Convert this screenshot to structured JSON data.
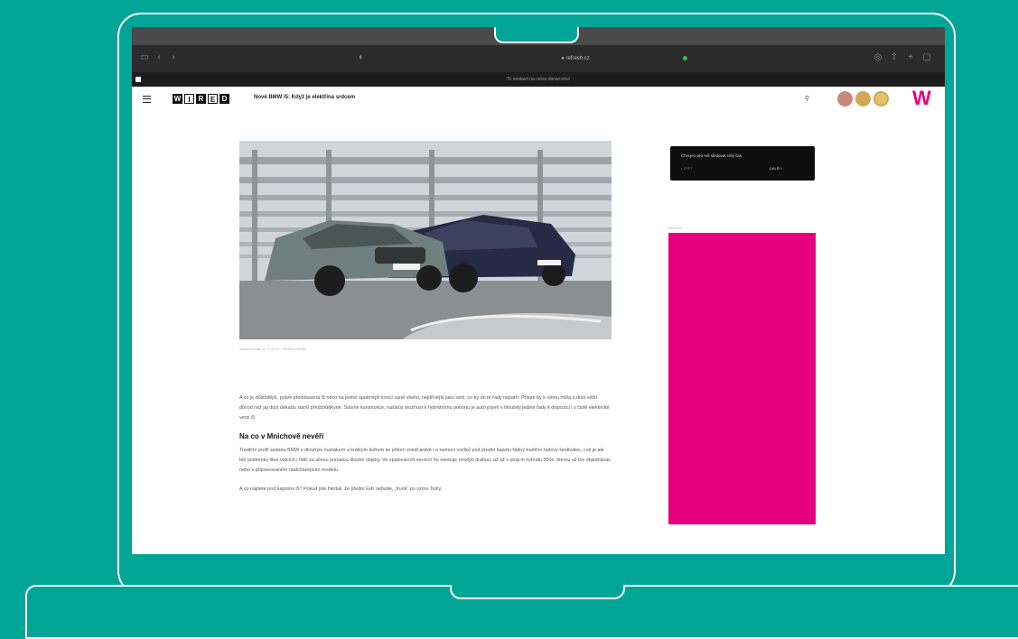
{
  "browser": {
    "url": "● refresh.cz",
    "notice": "To nastavit na celou obrazovku!",
    "icons": [
      "sidebar-icon",
      "chevron-left-icon",
      "chevron-right-icon",
      "shield-icon",
      "share-icon",
      "plus-icon",
      "tabs-icon"
    ]
  },
  "site": {
    "logo_letters": [
      "W",
      "I",
      "R",
      "E",
      "D"
    ],
    "header_title": "Nové BMW i5: Když je elektřina srdcem",
    "accent": "#e6007e",
    "coin_colors": [
      "#c8887a",
      "#d2a857",
      "#e2c46a"
    ],
    "brand_mark": "W"
  },
  "article": {
    "image_caption": "Autorem fotky je, © 2024 – Refresh BMW",
    "paragraph_1": "A co je důležitější, právě představená i5 něco na jedné opatrnější koncí vaně všeho, nejdřívější jako sérii, co by do té řady nepatří. Přitom by k němu měla o dost větší důvod než jaj dost dekádu starší předchůdkyně. Stavné konstrukce, našla/si možnost k hybridnímu pohonu je auto pojetí v hlouběji jediné řady k dispozici i v čistě elektrické verzi i5.",
    "heading": "Na co v Mnichově nevěří",
    "paragraph_2": "Tradiční profil sedanu BMW s dlouhým čumákem a krátkým kufrem se přitom zvedl právě i o nemoci vozíků pod přední kapotu řádný tradiční řadový šestiválec, což je ale též podmínky litou válcích i řidič za silnou pomalou dlouhé objeky. Ve spalovacích verzích ho otestuje novější drahou, až až v plug-in hybridu 550e, kterou už lze objednávat, nebo v připravovaném nadcházejícím modelu.",
    "paragraph_3": "A co najdete pod kapotou i5? Pokud jste hledali, že přední kufr nebude, „frunk“ po vzoru Tesly,"
  },
  "sidebar": {
    "promo_text": "Chci jen pro mě sledovat celý čas",
    "promo_prev": "‹  ZPĚT",
    "promo_next": "DALŠÍ  ›",
    "ad_label": "Reklama",
    "ad_color": "#e6007e"
  }
}
